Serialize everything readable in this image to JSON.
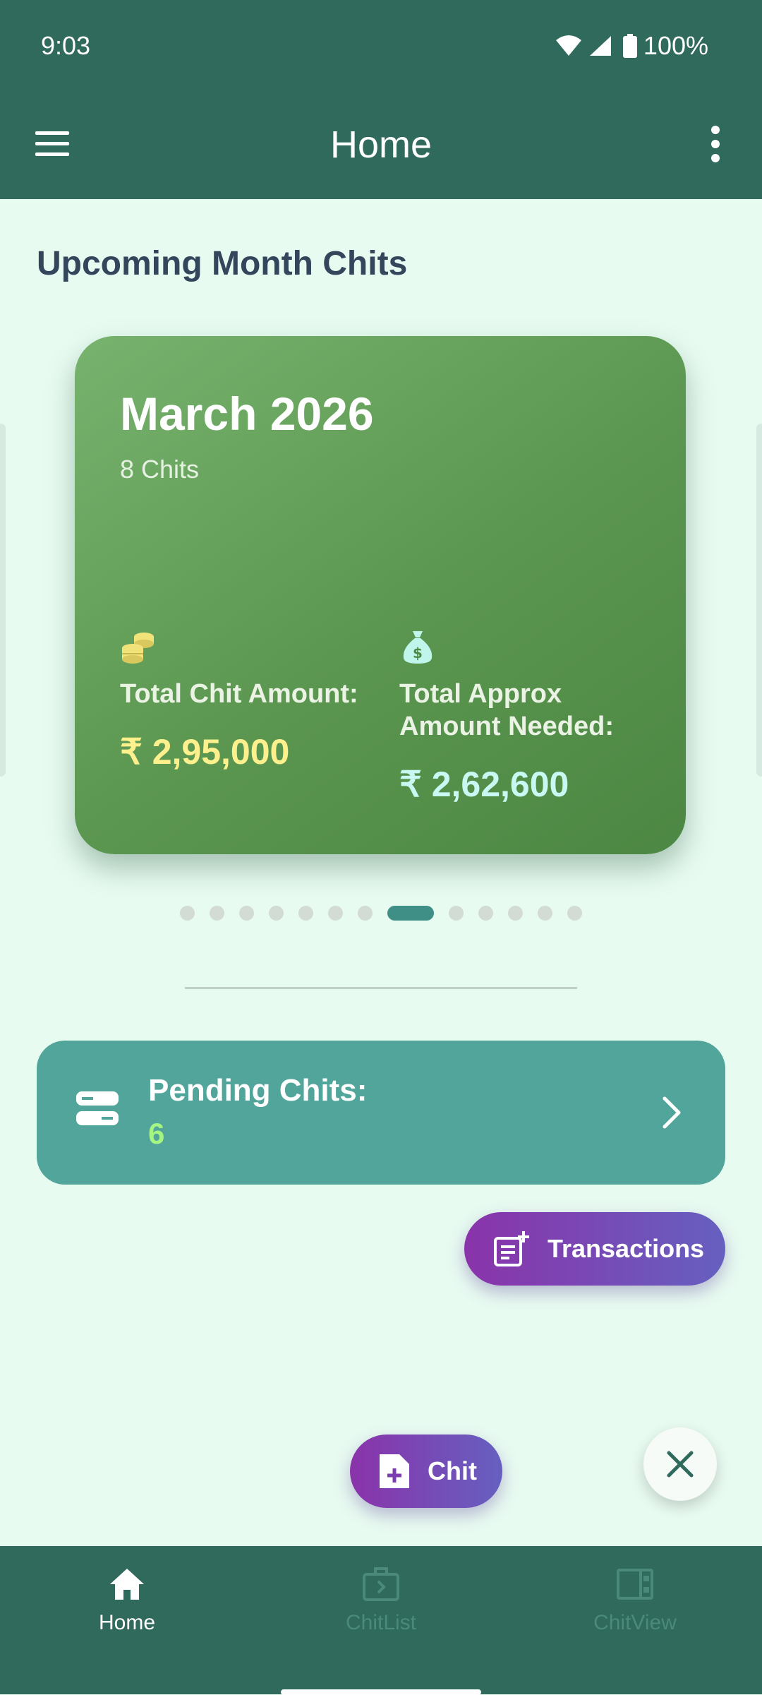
{
  "status_bar": {
    "time": "9:03",
    "battery": "100%"
  },
  "app_bar": {
    "title": "Home"
  },
  "section": {
    "title": "Upcoming Month Chits"
  },
  "month_card": {
    "month": "March 2026",
    "chit_count": "8 Chits",
    "total_chit_label": "Total Chit Amount:",
    "total_chit_value": "₹ 2,95,000",
    "approx_label": "Total Approx Amount Needed:",
    "approx_value": "₹ 2,62,600"
  },
  "carousel": {
    "page_count": 13,
    "active_index": 7
  },
  "pending": {
    "label": "Pending Chits:",
    "count": "6"
  },
  "fabs": {
    "transactions_label": "Transactions",
    "chit_label": "Chit"
  },
  "bottom_nav": {
    "items": [
      {
        "label": "Home",
        "icon": "home-icon",
        "active": true
      },
      {
        "label": "ChitList",
        "icon": "briefcase-icon",
        "active": false
      },
      {
        "label": "ChitView",
        "icon": "view-icon",
        "active": false
      }
    ]
  },
  "colors": {
    "primary": "#2f6a5c",
    "background": "#e8fbf1",
    "card_green": "#5b9650",
    "pending_teal": "#52a59a",
    "accent_yellow": "#fdf08d",
    "fab_purple": "#8a33aa"
  }
}
